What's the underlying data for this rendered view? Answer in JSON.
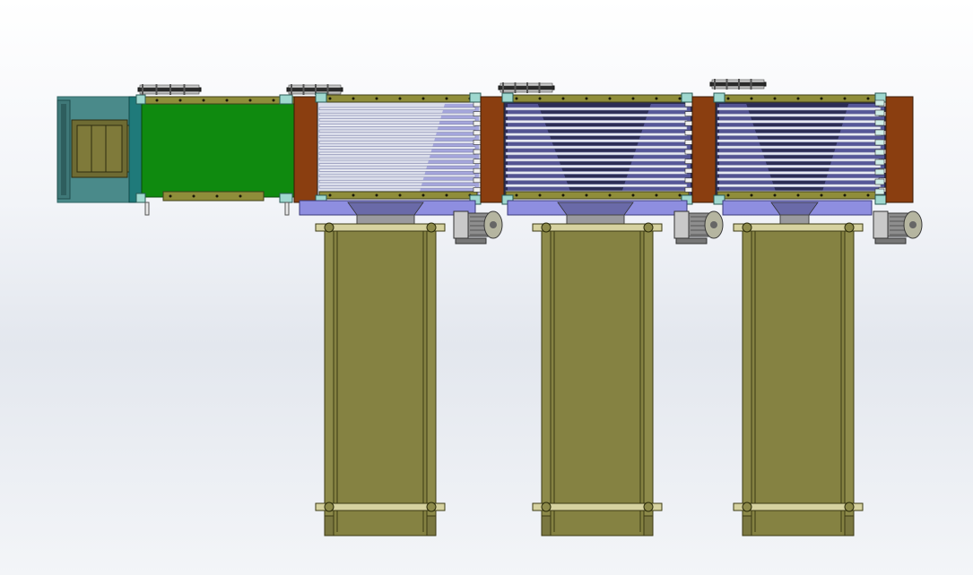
{
  "scene": {
    "background_top": "#ffffff",
    "background_bottom": "#e4e8ef"
  },
  "colors": {
    "feed_frame": "#4a8a8a",
    "feed_frame_dark": "#2f6464",
    "feed_hopper": "#7f7a3a",
    "green_belt": "#0f8a0f",
    "rail_olive": "#8f8d3a",
    "rail_olive_dark": "#3f3e18",
    "brown_roller": "#8a3e10",
    "slat_light": "#e8eaf2",
    "slat_shadow": "#7b7fa8",
    "hopper_purple": "#7a7ad0",
    "chute_gray": "#9a9a9e",
    "leg_olive": "#858242",
    "leg_edge": "#3c3a14",
    "motor_gray": "#8e8e8e",
    "motor_dark": "#3a3a3a"
  },
  "components": [
    {
      "kind": "feed-unit",
      "icon": "feed-hopper-icon"
    },
    {
      "kind": "green-conveyor",
      "icon": "belt-conveyor-icon"
    },
    {
      "kind": "slat-dryer",
      "index": 1,
      "icon": "slat-belt-icon"
    },
    {
      "kind": "slat-dryer",
      "index": 2,
      "icon": "slat-belt-icon"
    },
    {
      "kind": "slat-dryer",
      "index": 3,
      "icon": "slat-belt-icon"
    },
    {
      "kind": "incline-conveyor",
      "index": 1,
      "icon": "incline-conveyor-icon"
    },
    {
      "kind": "incline-conveyor",
      "index": 2,
      "icon": "incline-conveyor-icon"
    },
    {
      "kind": "incline-conveyor",
      "index": 3,
      "icon": "incline-conveyor-icon"
    },
    {
      "kind": "drive-motor",
      "index": 1,
      "icon": "motor-icon"
    },
    {
      "kind": "drive-motor",
      "index": 2,
      "icon": "motor-icon"
    },
    {
      "kind": "drive-motor",
      "index": 3,
      "icon": "motor-icon"
    }
  ]
}
